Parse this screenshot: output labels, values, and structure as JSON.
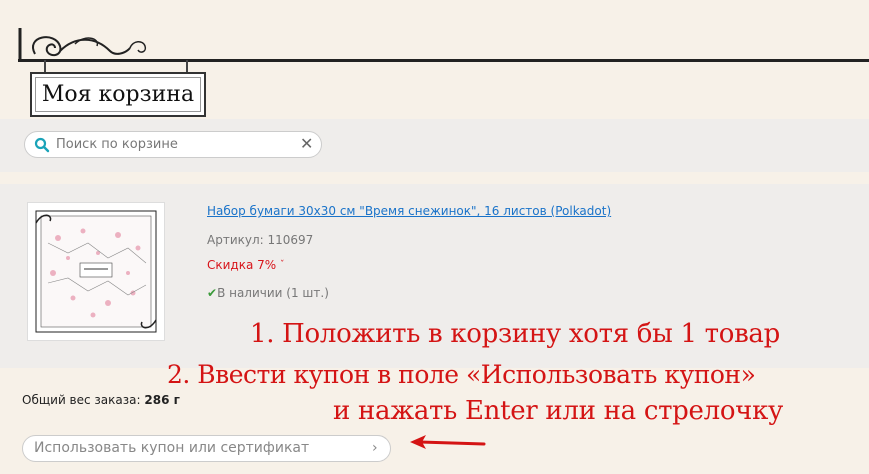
{
  "header": {
    "title": "Моя корзина"
  },
  "search": {
    "placeholder": "Поиск по корзине"
  },
  "product": {
    "name": "Набор бумаги 30х30 см \"Время снежинок\", 16 листов (Polkadot)",
    "sku": "Артикул: 110697",
    "discount": "Скидка 7%",
    "stock": "В наличии (1 шт.)"
  },
  "annotations": {
    "step1": "1. Положить в корзину хотя бы 1 товар",
    "step2": "2. Ввести купон в поле «Использовать купон»",
    "step3": "и нажать Enter или на стрелочку"
  },
  "order": {
    "weight_label": "Общий вес заказа:",
    "weight_value": "286 г"
  },
  "coupon": {
    "placeholder": "Использовать купон или сертификат"
  },
  "colors": {
    "accent_red": "#d41414",
    "link_blue": "#1a73c9",
    "stock_green": "#3a9a3a"
  }
}
